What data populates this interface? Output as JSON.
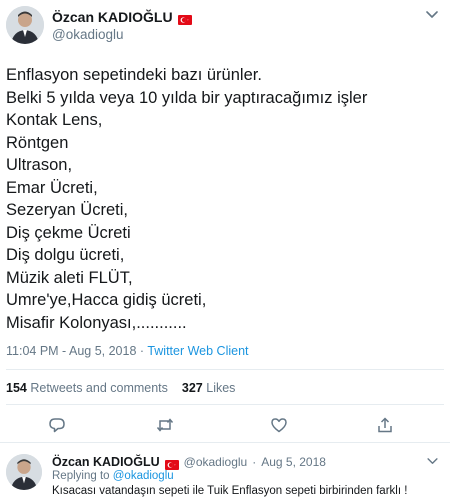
{
  "tweet": {
    "author": {
      "name": "Özcan KADIOĞLU",
      "handle": "@okadioglu"
    },
    "text_lines": [
      "Enflasyon sepetindeki bazı ürünler.",
      "Belki 5 yılda veya 10 yılda bir yaptıracağımız işler",
      "Kontak Lens,",
      "Röntgen",
      "Ultrason,",
      "Emar Ücreti,",
      "Sezeryan Ücreti,",
      "Diş çekme Ücreti",
      "Diş dolgu ücreti,",
      "Müzik aleti FLÜT,",
      "Umre'ye,Hacca gidiş ücreti,",
      "Misafir Kolonyası,..........."
    ],
    "timestamp": "11:04 PM - Aug 5, 2018",
    "separator": " · ",
    "client": "Twitter Web Client",
    "retweets_count": "154",
    "retweets_label": "Retweets and comments",
    "likes_count": "327",
    "likes_label": "Likes"
  },
  "reply": {
    "name": "Özcan KADIOĞLU",
    "handle": "@okadioglu",
    "separator": "·",
    "date": "Aug 5, 2018",
    "replying_prefix": "Replying to",
    "replying_to": "@okadioglu",
    "text": "Kısacası vatandaşın sepeti ile Tuik Enflasyon sepeti birbirinden farklı !"
  },
  "colors": {
    "link": "#1b95e0",
    "secondary_text": "#657786",
    "flag_red": "#e30a17"
  },
  "icons": [
    "reply-icon",
    "retweet-icon",
    "like-icon",
    "share-icon",
    "chevron-down-icon",
    "turkey-flag-icon"
  ]
}
